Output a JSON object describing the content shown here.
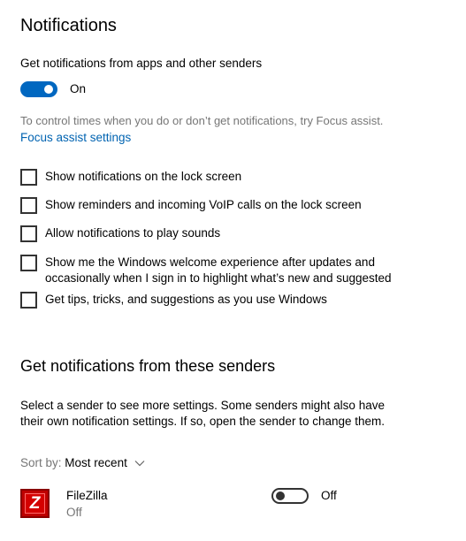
{
  "page": {
    "title": "Notifications"
  },
  "main_toggle": {
    "label": "Get notifications from apps and other senders",
    "state_label": "On"
  },
  "focus_assist": {
    "hint": "To control times when you do or don’t get notifications, try Focus assist.",
    "link": "Focus assist settings"
  },
  "checkboxes": [
    {
      "label": "Show notifications on the lock screen",
      "checked": false
    },
    {
      "label": "Show reminders and incoming VoIP calls on the lock screen",
      "checked": false
    },
    {
      "label": "Allow notifications to play sounds",
      "checked": false
    },
    {
      "label_line1": "Show me the Windows welcome experience after updates and",
      "label_line2": "occasionally when I sign in to highlight what’s new and suggested",
      "checked": false
    },
    {
      "label": "Get tips, tricks, and suggestions as you use Windows",
      "checked": false
    }
  ],
  "senders": {
    "title": "Get notifications from these senders",
    "desc_line1": "Select a sender to see more settings. Some senders might also have",
    "desc_line2": "their own notification settings. If so, open the sender to change them.",
    "sort_label": "Sort by:",
    "sort_value": "Most recent",
    "items": [
      {
        "name": "FileZilla",
        "status": "Off",
        "toggle_label": "Off",
        "icon": "filezilla-icon",
        "icon_letter": "Z"
      }
    ]
  },
  "colors": {
    "accent": "#0067c0",
    "link": "#0063b1",
    "muted": "#767676"
  }
}
